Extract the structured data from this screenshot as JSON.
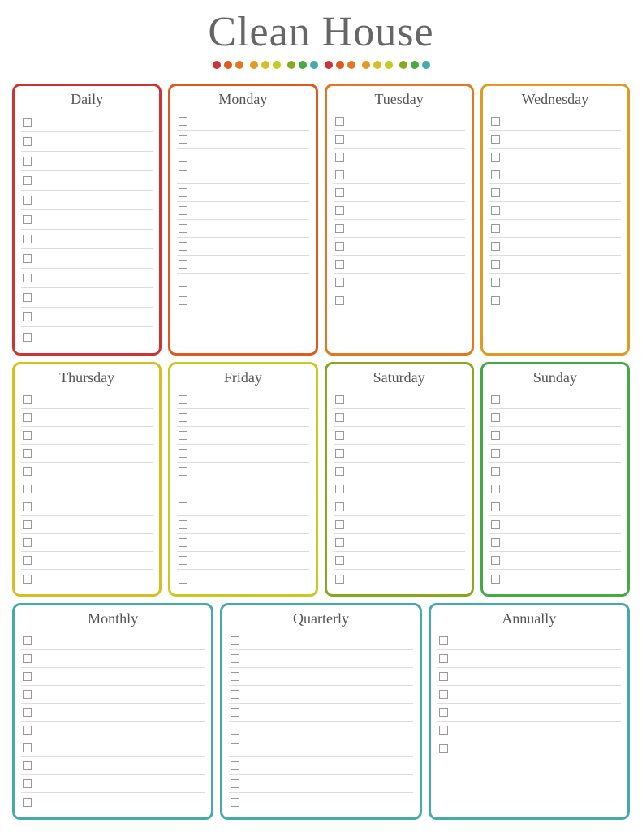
{
  "title": "Clean House",
  "dots": [
    "d1",
    "d2",
    "d3",
    "d4",
    "d5",
    "d6",
    "d7",
    "d8",
    "d9",
    "d1",
    "d2",
    "d3",
    "d4",
    "d5",
    "d6",
    "d7",
    "d8",
    "d9"
  ],
  "sections": {
    "daily": {
      "label": "Daily",
      "rows": 12
    },
    "monday": {
      "label": "Monday",
      "rows": 11
    },
    "tuesday": {
      "label": "Tuesday",
      "rows": 11
    },
    "wednesday": {
      "label": "Wednesday",
      "rows": 11
    },
    "thursday": {
      "label": "Thursday",
      "rows": 11
    },
    "friday": {
      "label": "Friday",
      "rows": 11
    },
    "saturday": {
      "label": "Saturday",
      "rows": 11
    },
    "sunday": {
      "label": "Sunday",
      "rows": 11
    },
    "monthly": {
      "label": "Monthly",
      "rows": 10
    },
    "quarterly": {
      "label": "Quarterly",
      "rows": 10
    },
    "annually": {
      "label": "Annually",
      "rows": 7
    }
  }
}
